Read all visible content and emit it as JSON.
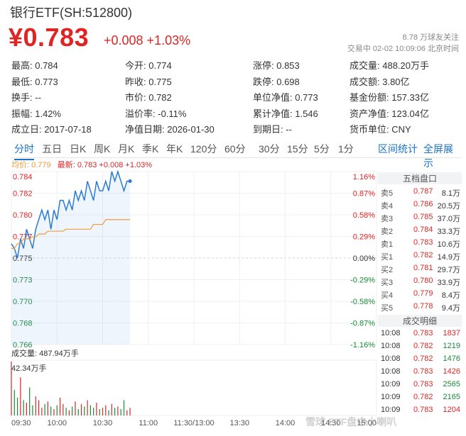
{
  "title": "银行ETF(SH:512800)",
  "price": "¥0.783",
  "change": "+0.008 +1.03%",
  "followers": "8.78 万球友关注",
  "status": "交易中 02-02 10:09:06 北京时间",
  "quote_rows": [
    [
      {
        "label": "最高:",
        "value": "0.784",
        "cls": "up"
      },
      {
        "label": "今开:",
        "value": "0.774",
        "cls": "down"
      },
      {
        "label": "涨停:",
        "value": "0.853",
        "cls": "up"
      },
      {
        "label": "成交量:",
        "value": "488.20万手",
        "cls": ""
      }
    ],
    [
      {
        "label": "最低:",
        "value": "0.773",
        "cls": "down"
      },
      {
        "label": "昨收:",
        "value": "0.775",
        "cls": ""
      },
      {
        "label": "跌停:",
        "value": "0.698",
        "cls": "down"
      },
      {
        "label": "成交额:",
        "value": "3.80亿",
        "cls": ""
      }
    ],
    [
      {
        "label": "换手:",
        "value": "--",
        "cls": ""
      },
      {
        "label": "市价:",
        "value": "0.782",
        "cls": ""
      },
      {
        "label": "单位净值:",
        "value": "0.773",
        "cls": ""
      },
      {
        "label": "基金份额:",
        "value": "157.33亿",
        "cls": ""
      }
    ],
    [
      {
        "label": "振幅:",
        "value": "1.42%",
        "cls": ""
      },
      {
        "label": "溢价率:",
        "value": "-0.11%",
        "cls": ""
      },
      {
        "label": "累计净值:",
        "value": "1.546",
        "cls": ""
      },
      {
        "label": "资产净值:",
        "value": "123.04亿",
        "cls": ""
      }
    ],
    [
      {
        "label": "成立日:",
        "value": "2017-07-18",
        "cls": ""
      },
      {
        "label": "净值日期:",
        "value": "2026-01-30",
        "cls": ""
      },
      {
        "label": "到期日:",
        "value": "--",
        "cls": ""
      },
      {
        "label": "货币单位:",
        "value": "CNY",
        "cls": ""
      }
    ]
  ],
  "tabs": [
    "分时",
    "五日",
    "日K",
    "周K",
    "月K",
    "季K",
    "年K",
    "120分",
    "60分",
    "30分",
    "15分",
    "5分",
    "1分"
  ],
  "tabs_right": [
    "区间统计",
    "全屏展示"
  ],
  "legend": {
    "avg": "均价: 0.779",
    "latest": "最新: 0.783 +0.008 +1.03%"
  },
  "orderbook_title": "五档盘口",
  "orderbook": [
    {
      "label": "卖5",
      "price": "0.787",
      "vol": "8.1万",
      "cls": "up"
    },
    {
      "label": "卖4",
      "price": "0.786",
      "vol": "20.5万",
      "cls": "up"
    },
    {
      "label": "卖3",
      "price": "0.785",
      "vol": "37.0万",
      "cls": "up"
    },
    {
      "label": "卖2",
      "price": "0.784",
      "vol": "33.3万",
      "cls": "up"
    },
    {
      "label": "卖1",
      "price": "0.783",
      "vol": "10.6万",
      "cls": "up"
    },
    {
      "label": "买1",
      "price": "0.782",
      "vol": "14.9万",
      "cls": "up"
    },
    {
      "label": "买2",
      "price": "0.781",
      "vol": "29.7万",
      "cls": "up"
    },
    {
      "label": "买3",
      "price": "0.780",
      "vol": "33.9万",
      "cls": "up"
    },
    {
      "label": "买4",
      "price": "0.779",
      "vol": "8.4万",
      "cls": "up"
    },
    {
      "label": "买5",
      "price": "0.778",
      "vol": "9.4万",
      "cls": "up"
    }
  ],
  "deals_title": "成交明细",
  "deals": [
    {
      "time": "10:08",
      "price": "0.783",
      "vol": "1837",
      "pcls": "up",
      "vcls": "up"
    },
    {
      "time": "10:08",
      "price": "0.782",
      "vol": "1219",
      "pcls": "up",
      "vcls": "down"
    },
    {
      "time": "10:08",
      "price": "0.782",
      "vol": "1476",
      "pcls": "up",
      "vcls": "down"
    },
    {
      "time": "10:08",
      "price": "0.783",
      "vol": "1426",
      "pcls": "up",
      "vcls": "up"
    },
    {
      "time": "10:09",
      "price": "0.783",
      "vol": "2565",
      "pcls": "up",
      "vcls": "down"
    },
    {
      "time": "10:09",
      "price": "0.782",
      "vol": "2165",
      "pcls": "up",
      "vcls": "down"
    },
    {
      "time": "10:09",
      "price": "0.783",
      "vol": "1204",
      "pcls": "up",
      "vcls": "up"
    }
  ],
  "volume_label": "成交量: 487.94万手",
  "volume_max_label": "42.34万手",
  "watermark": "雪球 ETF盘中小喇叭",
  "chart_data": {
    "type": "line",
    "yticks_left": [
      "0.784",
      "0.782",
      "0.780",
      "0.777",
      "0.775",
      "0.773",
      "0.770",
      "0.768",
      "0.766"
    ],
    "yticks_right": [
      "1.16%",
      "0.87%",
      "0.58%",
      "0.29%",
      "0.00%",
      "-0.29%",
      "-0.58%",
      "-0.87%",
      "-1.16%"
    ],
    "xticks": [
      "09:30",
      "10:00",
      "10:30",
      "11:00",
      "11:30/13:00",
      "13:30",
      "14:00",
      "14:30",
      "15:00"
    ],
    "ylim": [
      0.766,
      0.784
    ],
    "minutes_total": 240,
    "series": [
      {
        "name": "最新",
        "values": [
          0.7765,
          0.776,
          0.775,
          0.777,
          0.776,
          0.778,
          0.777,
          0.776,
          0.778,
          0.779,
          0.78,
          0.779,
          0.78,
          0.778,
          0.78,
          0.779,
          0.781,
          0.781,
          0.78,
          0.781,
          0.78,
          0.782,
          0.781,
          0.782,
          0.781,
          0.783,
          0.782,
          0.781,
          0.783,
          0.782,
          0.782,
          0.783,
          0.782,
          0.784,
          0.783,
          0.784,
          0.783,
          0.782,
          0.783,
          0.783
        ]
      },
      {
        "name": "均价",
        "values": [
          0.776,
          0.776,
          0.7765,
          0.7765,
          0.777,
          0.777,
          0.777,
          0.7772,
          0.7772,
          0.7775,
          0.7775,
          0.7775,
          0.7778,
          0.7778,
          0.7778,
          0.7778,
          0.7778,
          0.7778,
          0.778,
          0.778,
          0.778,
          0.778,
          0.778,
          0.778,
          0.778,
          0.778,
          0.778,
          0.7785,
          0.7785,
          0.7785,
          0.7785,
          0.779,
          0.779,
          0.779,
          0.779,
          0.779,
          0.779,
          0.779,
          0.779,
          0.779
        ]
      }
    ],
    "volume_values": [
      42.34,
      20,
      14,
      30,
      12,
      10,
      22,
      8,
      15,
      12,
      6,
      9,
      11,
      7,
      5,
      8,
      14,
      9,
      6,
      4,
      7,
      11,
      5,
      9,
      7,
      12,
      8,
      6,
      10,
      5,
      6,
      8,
      4,
      9,
      6,
      7,
      5,
      12,
      4,
      6
    ]
  }
}
